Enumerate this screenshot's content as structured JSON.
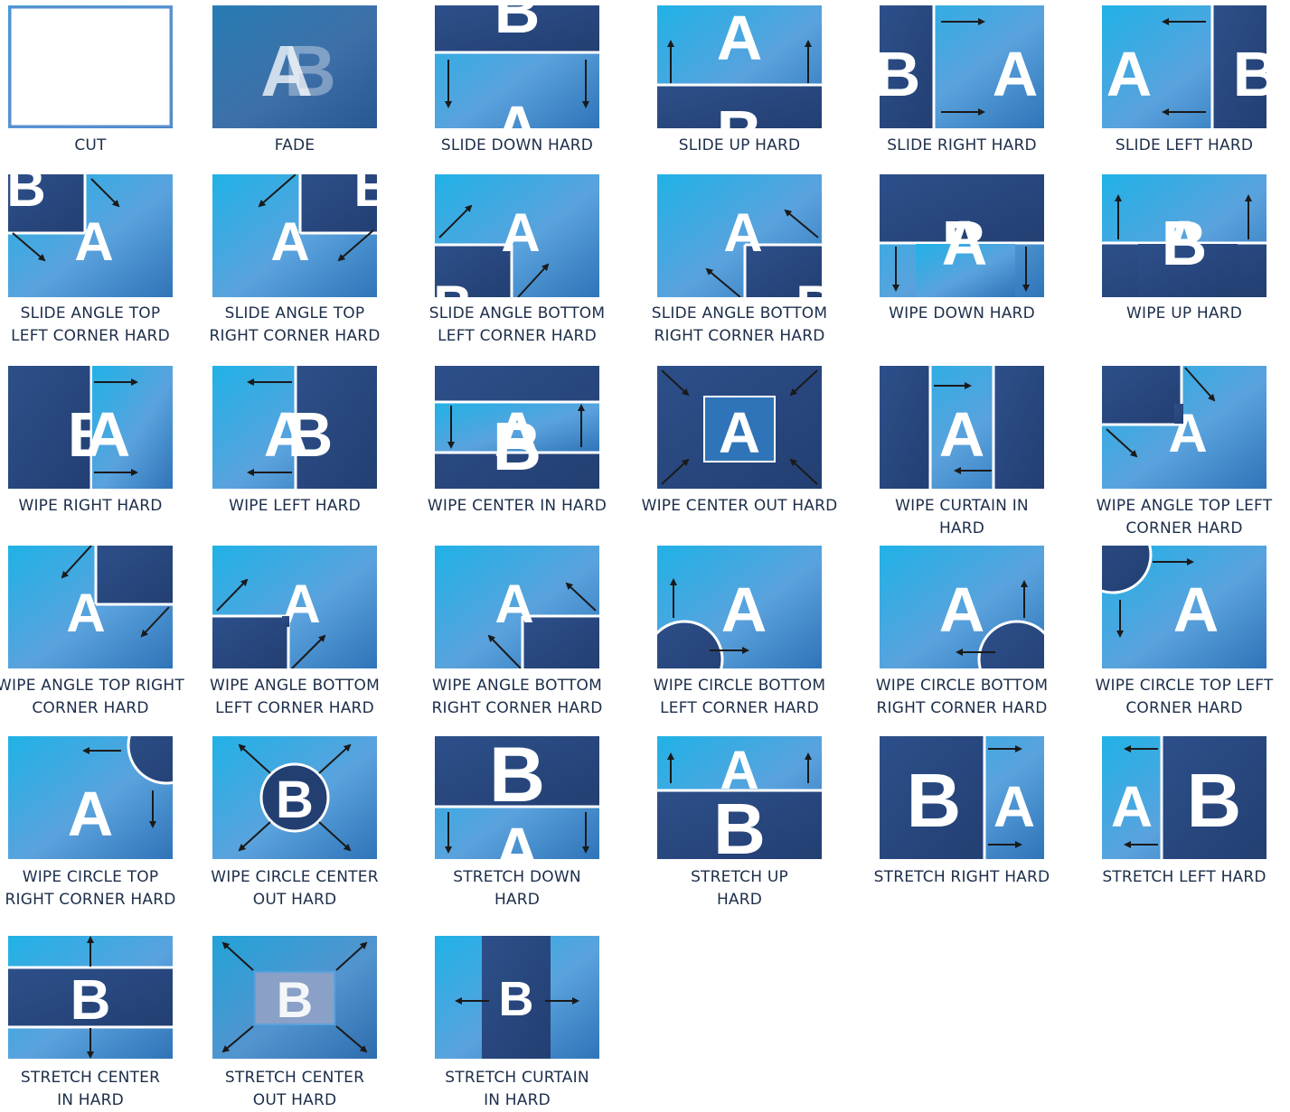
{
  "colors": {
    "dark": "#233f72",
    "mid": "#2f74b8",
    "light": "#5aa2dd",
    "cyan": "#20b2e6",
    "letter": "#ffffff",
    "label": "#1c2e4a",
    "arrow": "#1a1a1a"
  },
  "transitions": [
    {
      "id": "cut",
      "lines": [
        "CUT"
      ]
    },
    {
      "id": "fade",
      "lines": [
        "FADE"
      ]
    },
    {
      "id": "slide-down",
      "lines": [
        "SLIDE DOWN HARD"
      ]
    },
    {
      "id": "slide-up",
      "lines": [
        "SLIDE UP HARD"
      ]
    },
    {
      "id": "slide-right",
      "lines": [
        "SLIDE RIGHT HARD"
      ]
    },
    {
      "id": "slide-left",
      "lines": [
        "SLIDE LEFT HARD"
      ]
    },
    {
      "id": "slide-angle-tl",
      "lines": [
        "SLIDE ANGLE TOP",
        "LEFT CORNER HARD"
      ]
    },
    {
      "id": "slide-angle-tr",
      "lines": [
        "SLIDE ANGLE TOP",
        "RIGHT CORNER HARD"
      ]
    },
    {
      "id": "slide-angle-bl",
      "lines": [
        "SLIDE ANGLE BOTTOM",
        "LEFT CORNER HARD"
      ]
    },
    {
      "id": "slide-angle-br",
      "lines": [
        "SLIDE ANGLE BOTTOM",
        "RIGHT CORNER HARD"
      ]
    },
    {
      "id": "wipe-down",
      "lines": [
        "WIPE DOWN HARD"
      ]
    },
    {
      "id": "wipe-up",
      "lines": [
        "WIPE UP HARD"
      ]
    },
    {
      "id": "wipe-right",
      "lines": [
        "WIPE RIGHT HARD"
      ]
    },
    {
      "id": "wipe-left",
      "lines": [
        "WIPE LEFT HARD"
      ]
    },
    {
      "id": "wipe-center-in",
      "lines": [
        "WIPE CENTER IN HARD"
      ]
    },
    {
      "id": "wipe-center-out",
      "lines": [
        "WIPE CENTER OUT HARD"
      ]
    },
    {
      "id": "wipe-curtain-in",
      "lines": [
        "WIPE CURTAIN IN",
        "HARD"
      ]
    },
    {
      "id": "wipe-angle-tl",
      "lines": [
        "WIPE ANGLE TOP LEFT",
        "CORNER HARD"
      ]
    },
    {
      "id": "wipe-angle-tr",
      "lines": [
        "WIPE ANGLE TOP RIGHT",
        "CORNER HARD"
      ]
    },
    {
      "id": "wipe-angle-bl",
      "lines": [
        "WIPE ANGLE BOTTOM",
        "LEFT CORNER HARD"
      ]
    },
    {
      "id": "wipe-angle-br",
      "lines": [
        "WIPE ANGLE BOTTOM",
        "RIGHT CORNER HARD"
      ]
    },
    {
      "id": "wipe-circle-bl",
      "lines": [
        "WIPE CIRCLE BOTTOM",
        "LEFT CORNER HARD"
      ]
    },
    {
      "id": "wipe-circle-br",
      "lines": [
        "WIPE CIRCLE BOTTOM",
        "RIGHT CORNER HARD"
      ]
    },
    {
      "id": "wipe-circle-tl",
      "lines": [
        "WIPE CIRCLE TOP LEFT",
        "CORNER HARD"
      ]
    },
    {
      "id": "wipe-circle-tr",
      "lines": [
        "WIPE CIRCLE TOP",
        "RIGHT CORNER HARD"
      ]
    },
    {
      "id": "wipe-circle-center-out",
      "lines": [
        "WIPE CIRCLE CENTER",
        "OUT HARD"
      ]
    },
    {
      "id": "stretch-down",
      "lines": [
        "STRETCH DOWN",
        "HARD"
      ]
    },
    {
      "id": "stretch-up",
      "lines": [
        "STRETCH UP",
        "HARD"
      ]
    },
    {
      "id": "stretch-right",
      "lines": [
        "STRETCH RIGHT HARD"
      ]
    },
    {
      "id": "stretch-left",
      "lines": [
        "STRETCH LEFT HARD"
      ]
    },
    {
      "id": "stretch-center-in",
      "lines": [
        "STRETCH CENTER",
        "IN HARD"
      ]
    },
    {
      "id": "stretch-center-out",
      "lines": [
        "STRETCH CENTER",
        "OUT HARD"
      ]
    },
    {
      "id": "stretch-curtain-in",
      "lines": [
        "STRETCH CURTAIN",
        "IN HARD"
      ]
    }
  ]
}
